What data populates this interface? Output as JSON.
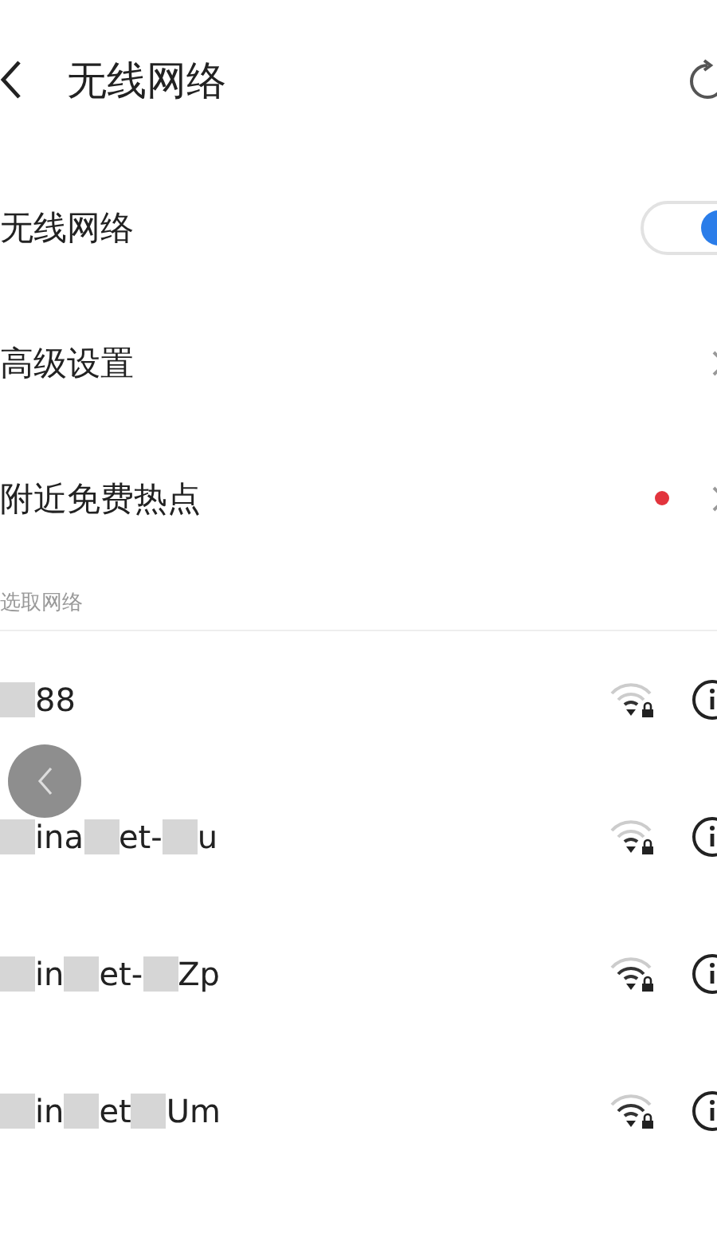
{
  "header": {
    "title": "无线网络"
  },
  "settings": [
    {
      "kind": "toggle",
      "label": "无线网络",
      "on": true
    },
    {
      "kind": "link",
      "label": "高级设置",
      "badge": false
    },
    {
      "kind": "link",
      "label": "附近免费热点",
      "badge": true
    }
  ],
  "section": {
    "title": "选取网络"
  },
  "networks": [
    {
      "name_parts": [
        "88"
      ],
      "locked": true
    },
    {
      "name_parts": [
        "ina",
        "et-",
        "u"
      ],
      "locked": true
    },
    {
      "name_parts": [
        "in",
        "et-",
        "Zp"
      ],
      "locked": true
    },
    {
      "name_parts": [
        "in",
        "et",
        "Um"
      ],
      "locked": true
    }
  ]
}
